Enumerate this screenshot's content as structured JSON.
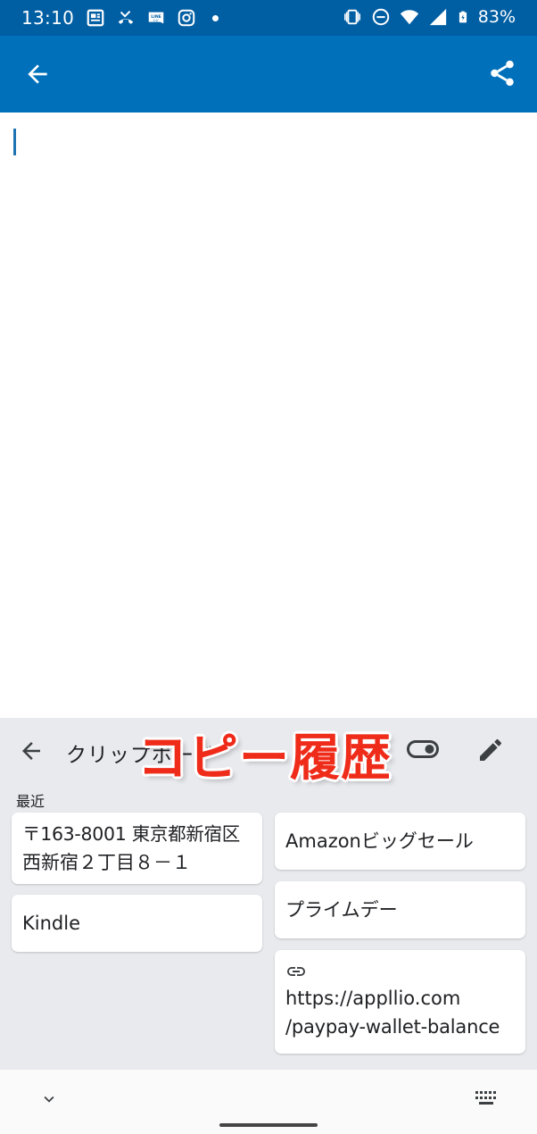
{
  "status_bar": {
    "time": "13:10",
    "battery": "83%",
    "left_icons": [
      "news-icon",
      "missed-call-icon",
      "line-manga-icon",
      "instagram-icon",
      "dot-icon"
    ],
    "right_icons": [
      "vibrate-icon",
      "dnd-icon",
      "wifi-icon",
      "signal-icon",
      "battery-icon"
    ],
    "bg_color": "#005ea3"
  },
  "app_bar": {
    "bg_color": "#0070bb",
    "back_icon": "arrow-back-icon",
    "share_icon": "share-icon"
  },
  "clipboard": {
    "title": "クリップボード",
    "overlay_label": "コピー履歴",
    "section_label": "最近",
    "left_items": [
      {
        "lines": [
          "〒163-8001 東京都新宿区",
          "西新宿２丁目８－１"
        ]
      },
      {
        "lines": [
          "Kindle"
        ]
      }
    ],
    "right_items": [
      {
        "lines": [
          "Amazonビッグセール"
        ]
      },
      {
        "lines": [
          "プライムデー"
        ]
      },
      {
        "lines": [
          "https://appllio.com",
          "/paypay-wallet-balance"
        ],
        "icon": "link-icon"
      }
    ],
    "accent_overlay": "#ef2b1a"
  }
}
